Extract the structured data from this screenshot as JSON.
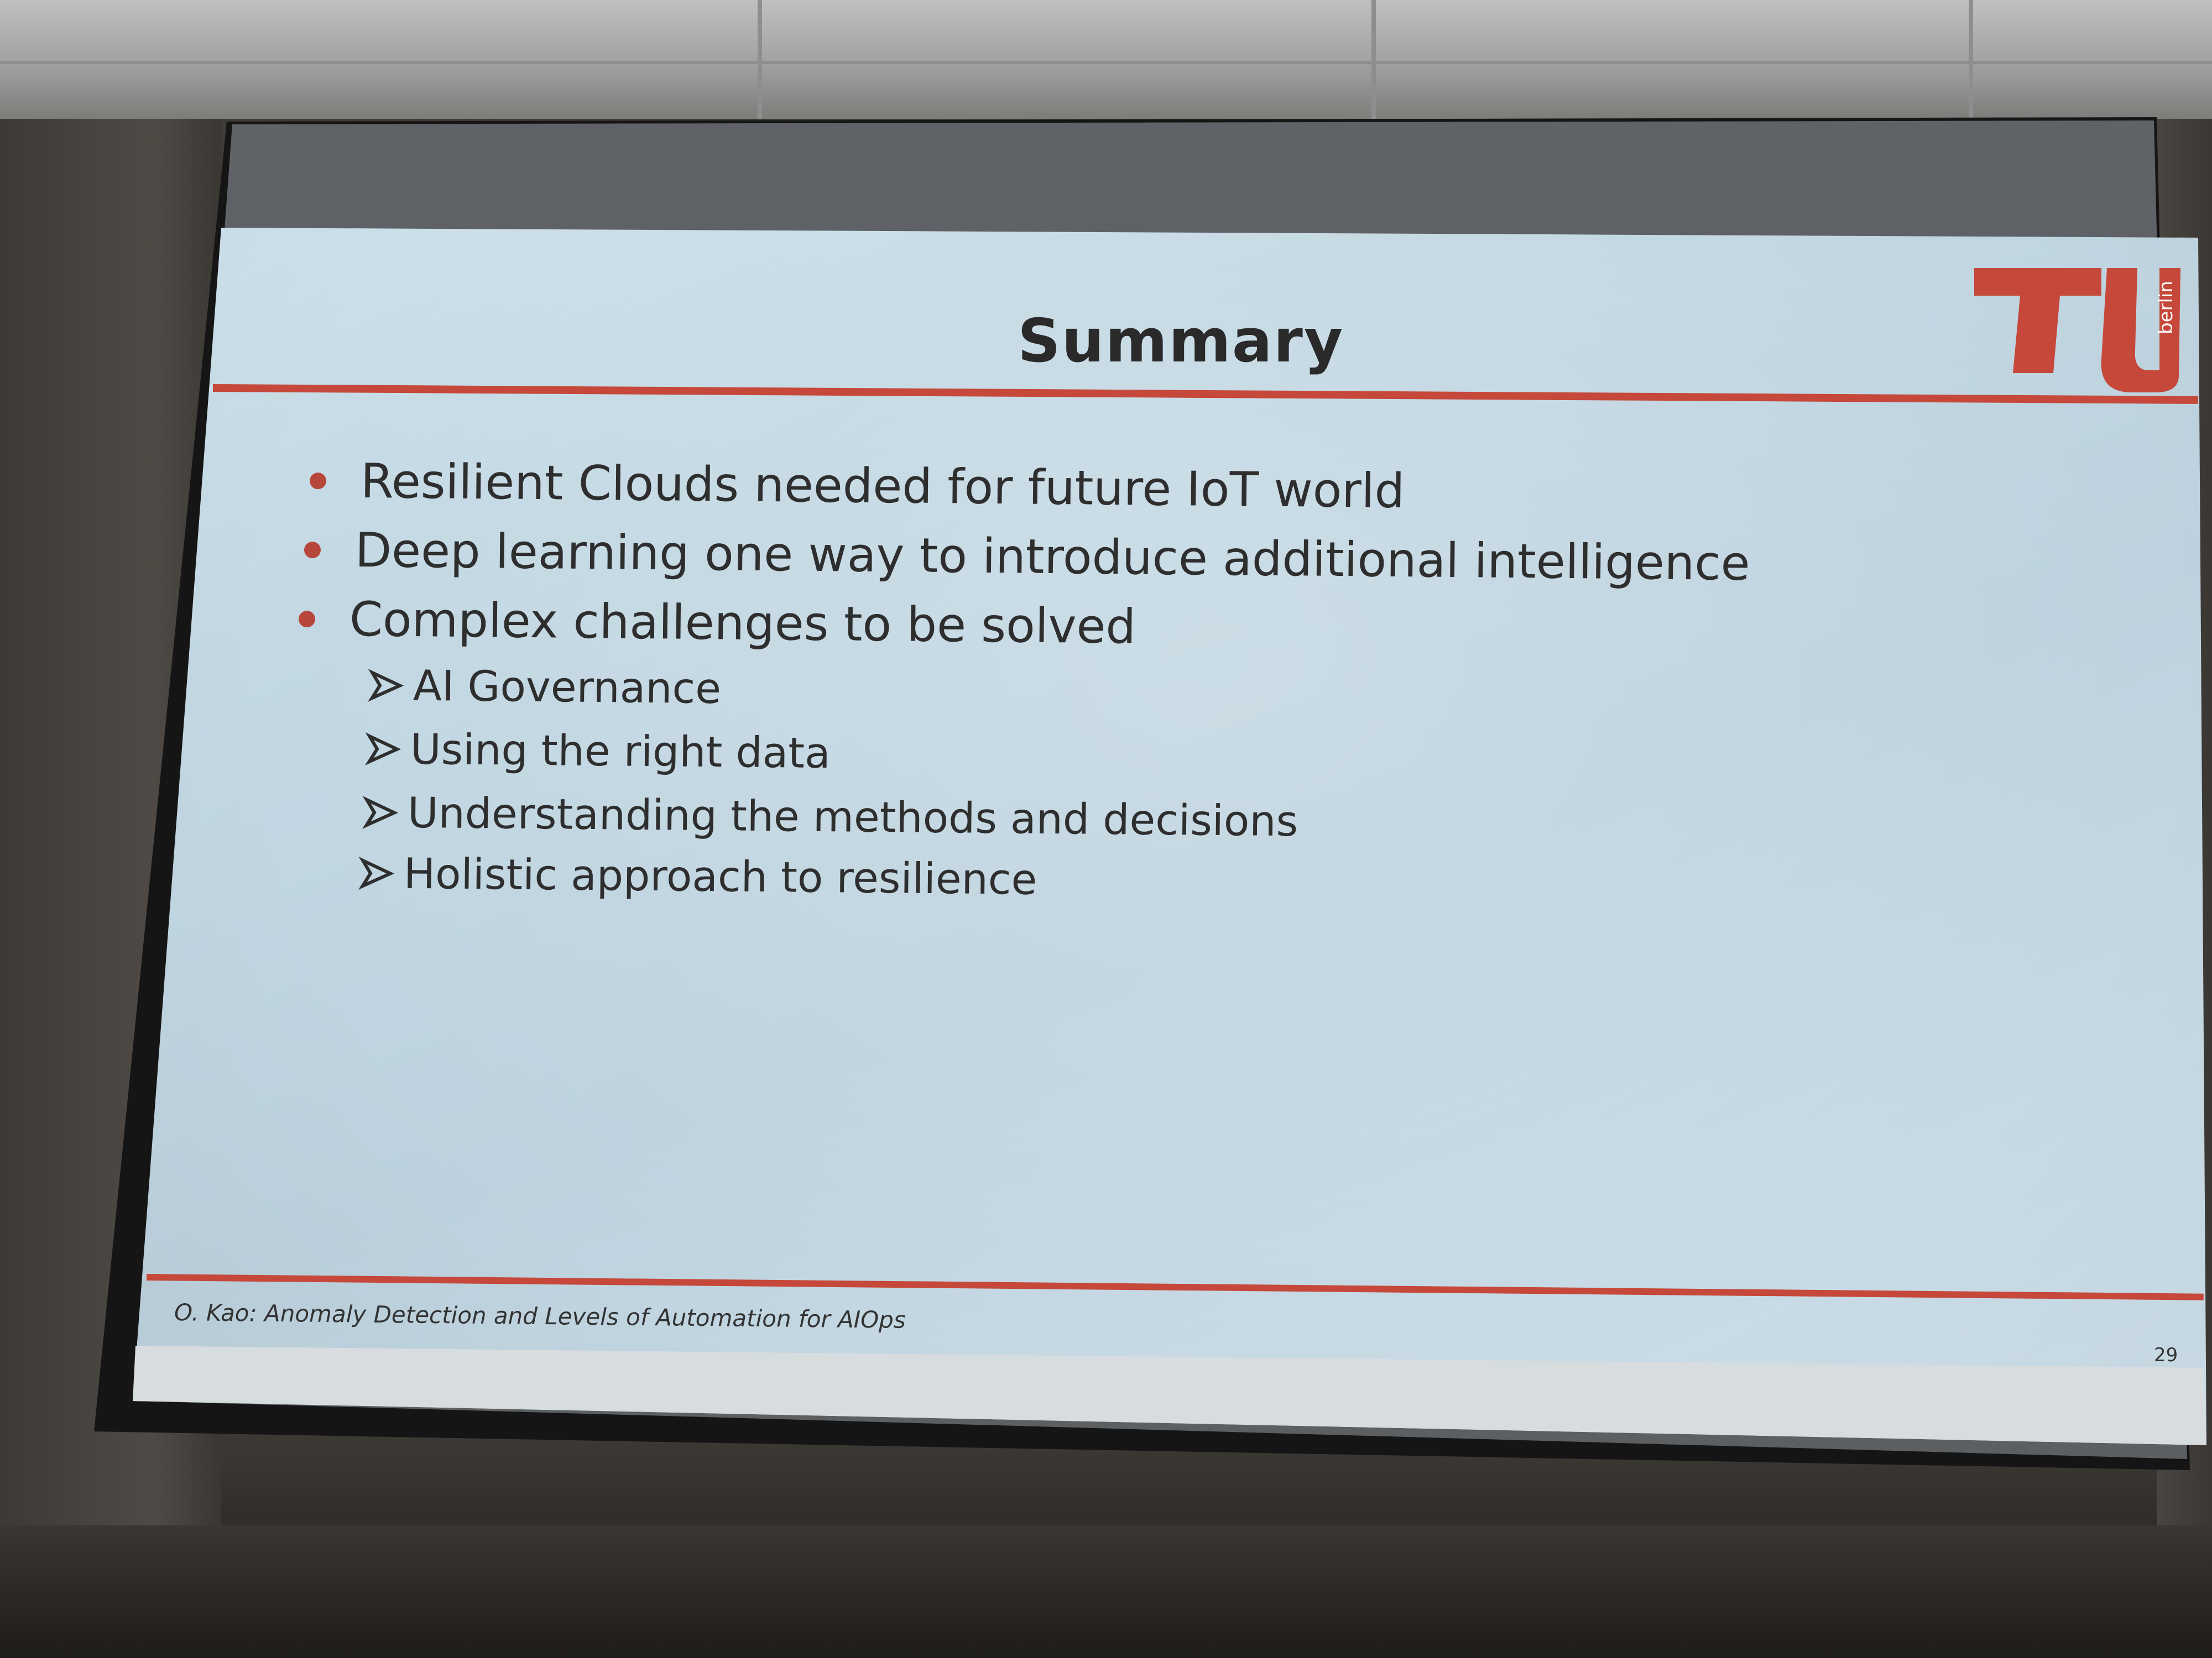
{
  "slide": {
    "title": "Summary",
    "bullets": [
      "Resilient Clouds needed for future IoT world",
      "Deep learning one way to introduce additional intelligence",
      "Complex challenges to be solved"
    ],
    "sub_bullets": [
      "AI Governance",
      "Using the right data",
      "Understanding the methods and decisions",
      "Holistic approach to resilience"
    ],
    "footer": "O. Kao: Anomaly Detection and Levels of Automation for AIOps",
    "page_number": "29",
    "logo": {
      "icon": "tu-berlin-logo",
      "text": "berlin"
    }
  },
  "colors": {
    "accent_red": "#c5483a",
    "slide_background": "#c3d8e3",
    "text": "#2e2e2e"
  }
}
